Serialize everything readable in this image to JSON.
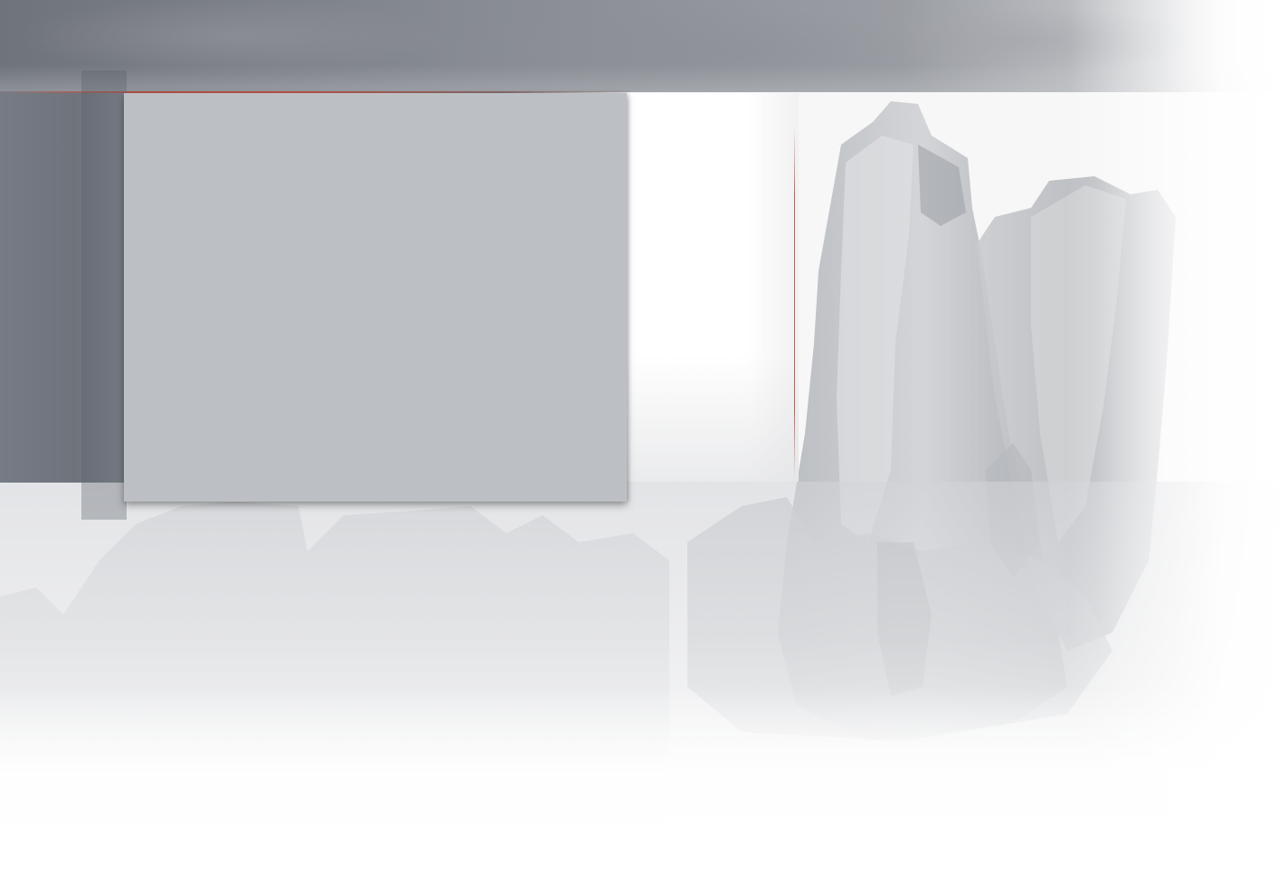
{
  "colors": {
    "band": "#868a91",
    "panel": "#bcc0c5",
    "left_column": "#767b84",
    "accent": "#c4574a",
    "background": "#f7f7f8"
  },
  "background_image": "rock-formations-photo"
}
